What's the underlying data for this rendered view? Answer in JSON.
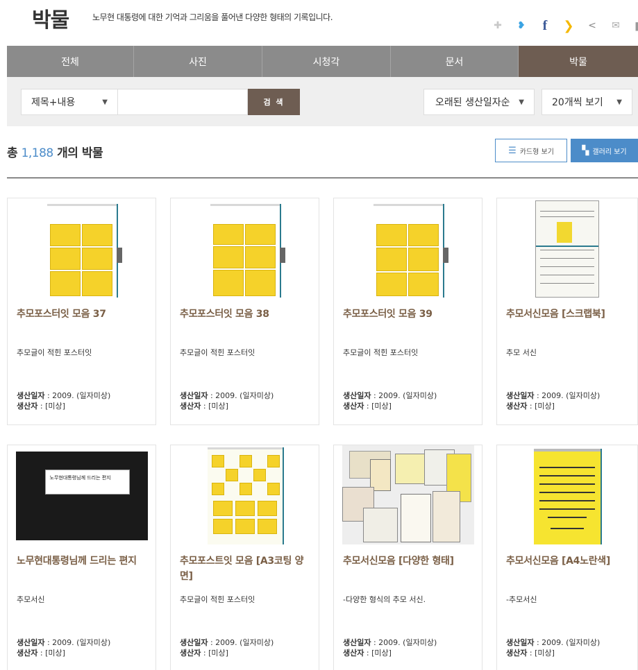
{
  "header": {
    "title": "박물",
    "description": "노무현 대통령에 대한 기억과 그리움을 풀어낸 다양한 형태의 기록입니다.",
    "share_icons": [
      "puzzle-icon",
      "twitter-icon",
      "facebook-icon",
      "kakaostory-icon",
      "share-icon",
      "mail-icon",
      "print-icon"
    ]
  },
  "tabs": [
    {
      "label": "전체",
      "active": false
    },
    {
      "label": "사진",
      "active": false
    },
    {
      "label": "시청각",
      "active": false
    },
    {
      "label": "문서",
      "active": false
    },
    {
      "label": "박물",
      "active": true
    }
  ],
  "search": {
    "field_select": "제목+내용",
    "input_value": "",
    "button_label": "검 색",
    "sort_select": "오래된 생산일자순",
    "per_page_select": "20개씩 보기"
  },
  "summary": {
    "prefix": "총",
    "count": "1,188",
    "suffix": "개의 박물"
  },
  "view_toggle": {
    "card_label": "카드형 보기",
    "gallery_label": "갤러리 보기",
    "active": "gallery"
  },
  "meta_labels": {
    "date_label": "생산일자",
    "producer_label": "생산자"
  },
  "items": [
    {
      "title": "추모포스터잇 모음 37",
      "desc": "추모글이 적힌 포스터잇",
      "date": " : 2009. (일자미상)",
      "producer": " : [미상]"
    },
    {
      "title": "추모포스터잇 모음 38",
      "desc": "추모글이 적힌 포스터잇",
      "date": " : 2009. (일자미상)",
      "producer": " : [미상]"
    },
    {
      "title": "추모포스터잇 모음 39",
      "desc": "추모글이 적힌 포스터잇",
      "date": " : 2009. (일자미상)",
      "producer": " : [미상]"
    },
    {
      "title": "추모서신모음 [스크랩북]",
      "desc": "추모 서신",
      "date": " : 2009. (일자미상)",
      "producer": " : [미상]"
    },
    {
      "title": "노무현대통령님께 드리는 편지",
      "desc": "추모서신",
      "date": " : 2009. (일자미상)",
      "producer": " : [미상]"
    },
    {
      "title": "추모포스트잇 모음 [A3코팅 양면]",
      "desc": "추모글이 적힌 포스터잇",
      "date": " : 2009. (일자미상)",
      "producer": " : [미상]"
    },
    {
      "title": "추모서신모음 [다양한 형태]",
      "desc": "-다양한 형식의 추모 서신.",
      "date": " : 2009. (일자미상)",
      "producer": " : [미상]"
    },
    {
      "title": "추모서신모음 [A4노란색]",
      "desc": "-추모서신",
      "date": " : 2009. (일자미상)",
      "producer": " : [미상]"
    }
  ],
  "thumb_texts": {
    "letter_label": "노무현대통령님께 드리는 편지"
  },
  "colors": {
    "active_tab": "#6e5d52",
    "tab": "#8b8b8b",
    "accent_blue": "#4c8cc9",
    "title_brown": "#7a5f46"
  }
}
